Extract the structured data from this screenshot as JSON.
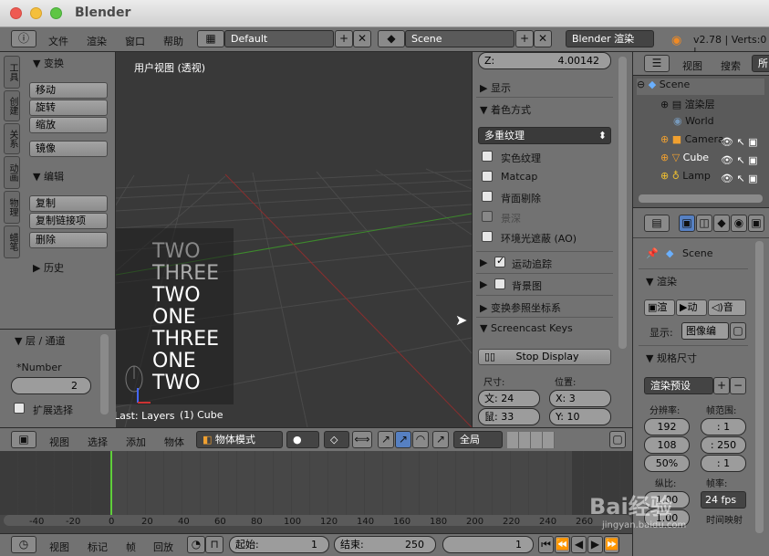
{
  "window": {
    "title": "Blender"
  },
  "info": {
    "menus": [
      "文件",
      "渲染",
      "窗口",
      "帮助"
    ],
    "layout": "Default",
    "scene": "Scene",
    "engine": "Blender 渲染",
    "version": "v2.78 | Verts:0 |"
  },
  "toolshelf": {
    "tabs": [
      "工具",
      "创建",
      "关系",
      "动画",
      "物理",
      "蜡笔"
    ],
    "transform": "变换",
    "move": "移动",
    "rotate": "旋转",
    "scale": "缩放",
    "mirror": "镜像",
    "edit": "编辑",
    "duplicate": "复制",
    "dup_linked": "复制链接项",
    "delete": "删除",
    "history": "历史"
  },
  "operator": {
    "title": "层 / 通道",
    "number_label": "*Number",
    "number_value": "2",
    "extend": "扩展选择",
    "last": "Last: Layers"
  },
  "viewport": {
    "label": "用户视图 (透视)",
    "object": "(1) Cube",
    "screencast": [
      "TWO",
      "THREE",
      "TWO",
      "ONE",
      "THREE",
      "ONE",
      "TWO"
    ]
  },
  "properties_panel": {
    "z_label": "Z:",
    "z_value": "4.00142",
    "display": "显示",
    "shading": "着色方式",
    "texture_mode": "多重纹理",
    "solid_tex": "实色纹理",
    "matcap": "Matcap",
    "backface": "背面剔除",
    "dof": "景深",
    "ao": "环境光遮蔽 (AO)",
    "motion": "运动追踪",
    "background": "背景图",
    "orientation": "变换参照坐标系",
    "screencast": "Screencast Keys",
    "stop": "Stop Display",
    "size": "尺寸:",
    "position": "位置:",
    "size_w": "文: 24",
    "size_h": "鼠: 33",
    "pos_x": "X: 3",
    "pos_y": "Y: 10"
  },
  "viewport_header": {
    "view": "视图",
    "select": "选择",
    "add": "添加",
    "object": "物体",
    "mode": "物体模式",
    "global": "全局"
  },
  "outliner": {
    "view": "视图",
    "search": "搜索",
    "all": "所",
    "items": [
      "Scene",
      "渲染层",
      "World",
      "Camera",
      "Cube",
      "Lamp"
    ]
  },
  "props": {
    "scene": "Scene",
    "render": "渲染",
    "render_btn": "渲",
    "anim_btn": "动",
    "audio_btn": "音",
    "display": "显示:",
    "display_val": "图像编",
    "dims": "规格尺寸",
    "preset": "渲染预设",
    "res": "分辨率:",
    "frange": "帧范围:",
    "rx": "192",
    "ry": "108",
    "pct": "50%",
    "fs": ": 1",
    "fe": ": 250",
    "fst": ": 1",
    "aspect": "纵比:",
    "fps_label": "帧率:",
    "fps": "24 fps",
    "remap": "时间映射",
    "aspect_val": "1.00"
  },
  "timeline": {
    "ticks": [
      "-40",
      "-20",
      "0",
      "20",
      "40",
      "60",
      "80",
      "100",
      "120",
      "140",
      "160",
      "180",
      "200",
      "220",
      "240",
      "260"
    ],
    "view": "视图",
    "marker": "标记",
    "frame": "帧",
    "playback": "回放",
    "start": "起始:",
    "start_v": "1",
    "end": "结束:",
    "end_v": "250",
    "current": "1"
  },
  "watermark": {
    "brand": "Bai经验",
    "url": "jingyan.baidu.com"
  }
}
